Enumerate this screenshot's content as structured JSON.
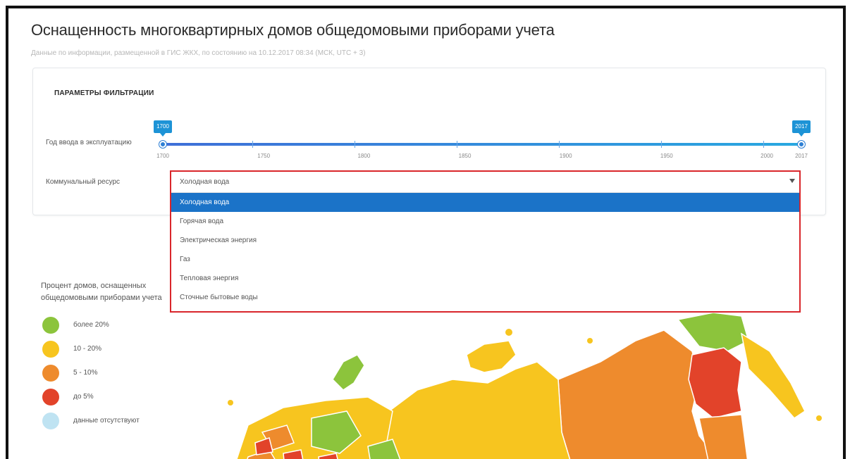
{
  "page": {
    "title": "Оснащенность многоквартирных домов общедомовыми приборами учета",
    "subtitle": "Данные по информации, размещенной в ГИС ЖКХ, по состоянию на 10.12.2017 08:34 (МСК, UTC + 3)"
  },
  "filters": {
    "title": "ПАРАМЕТРЫ ФИЛЬТРАЦИИ",
    "year_label": "Год ввода в эксплуатацию",
    "year_from": "1700",
    "year_to": "2017",
    "year_min": 1700,
    "year_max": 2017,
    "scale_labels": [
      "1700",
      "1750",
      "1800",
      "1850",
      "1900",
      "1950",
      "2000",
      "2017"
    ],
    "resource_label": "Коммунальный ресурс"
  },
  "dropdown": {
    "selected_value": "Холодная вода",
    "options": [
      "Холодная вода",
      "Горячая вода",
      "Электрическая энергия",
      "Газ",
      "Тепловая энергия",
      "Сточные бытовые воды"
    ]
  },
  "legend": {
    "title": "Процент домов, оснащенных общедомовыми приборами учета",
    "items": [
      {
        "label": "более 20%",
        "color": "#8cc43c"
      },
      {
        "label": "10 - 20%",
        "color": "#f7c51f"
      },
      {
        "label": "5 - 10%",
        "color": "#ee8b2d"
      },
      {
        "label": "до 5%",
        "color": "#e2432a"
      },
      {
        "label": "данные отсутствуют",
        "color": "#bfe3f2"
      }
    ]
  },
  "colors": {
    "accent": "#1b73c8",
    "highlight_border": "#d9262b"
  }
}
